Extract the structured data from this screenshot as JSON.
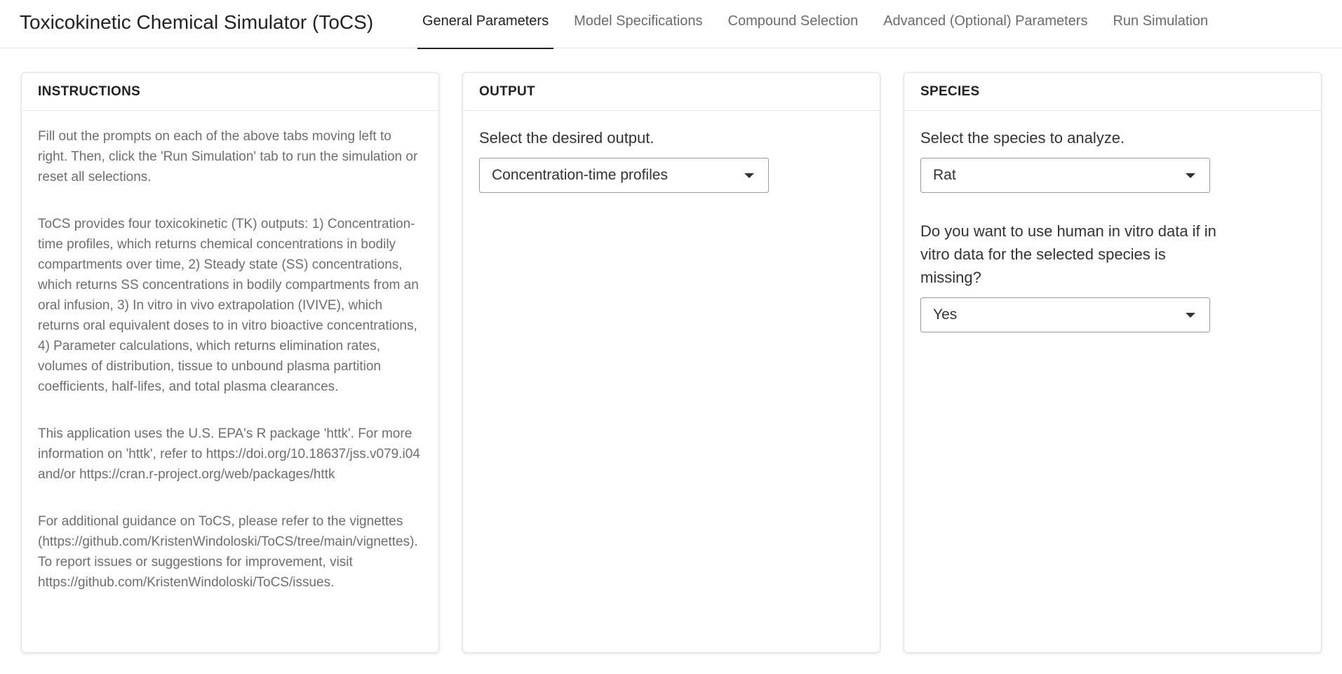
{
  "navbar": {
    "title": "Toxicokinetic Chemical Simulator (ToCS)",
    "tabs": [
      {
        "label": "General Parameters"
      },
      {
        "label": "Model Specifications"
      },
      {
        "label": "Compound Selection"
      },
      {
        "label": "Advanced (Optional) Parameters"
      },
      {
        "label": "Run Simulation"
      }
    ],
    "active_tab": "General Parameters"
  },
  "instructions": {
    "header": "INSTRUCTIONS",
    "paragraphs": [
      "Fill out the prompts on each of the above tabs moving left to right. Then, click the 'Run Simulation' tab to run the simulation or reset all selections.",
      "ToCS provides four toxicokinetic (TK) outputs: 1) Concentration-time profiles, which returns chemical concentrations in bodily compartments over time, 2) Steady state (SS) concentrations, which returns SS concentrations in bodily compartments from an oral infusion, 3) In vitro in vivo extrapolation (IVIVE), which returns oral equivalent doses to in vitro bioactive concentrations, 4) Parameter calculations, which returns elimination rates, volumes of distribution, tissue to unbound plasma partition coefficients, half-lifes, and total plasma clearances.",
      "This application uses the U.S. EPA's R package 'httk'. For more information on 'httk', refer to https://doi.org/10.18637/jss.v079.i04 and/or https://cran.r-project.org/web/packages/httk",
      "For additional guidance on ToCS, please refer to the vignettes (https://github.com/KristenWindoloski/ToCS/tree/main/vignettes). To report issues or suggestions for improvement, visit https://github.com/KristenWindoloski/ToCS/issues."
    ]
  },
  "output": {
    "header": "OUTPUT",
    "prompt": "Select the desired output.",
    "selected": "Concentration-time profiles"
  },
  "species": {
    "header": "SPECIES",
    "prompt": "Select the species to analyze.",
    "selected": "Rat",
    "human_data_prompt": "Do you want to use human in vitro data if in vitro data for the selected species is missing?",
    "human_data_selected": "Yes"
  },
  "colors": {
    "text_primary": "#222222",
    "text_muted": "#6e6e6e",
    "tab_inactive": "#6b6b6b",
    "border": "#e2e2e2"
  },
  "icons": {
    "dropdown": "caret-down-icon"
  }
}
